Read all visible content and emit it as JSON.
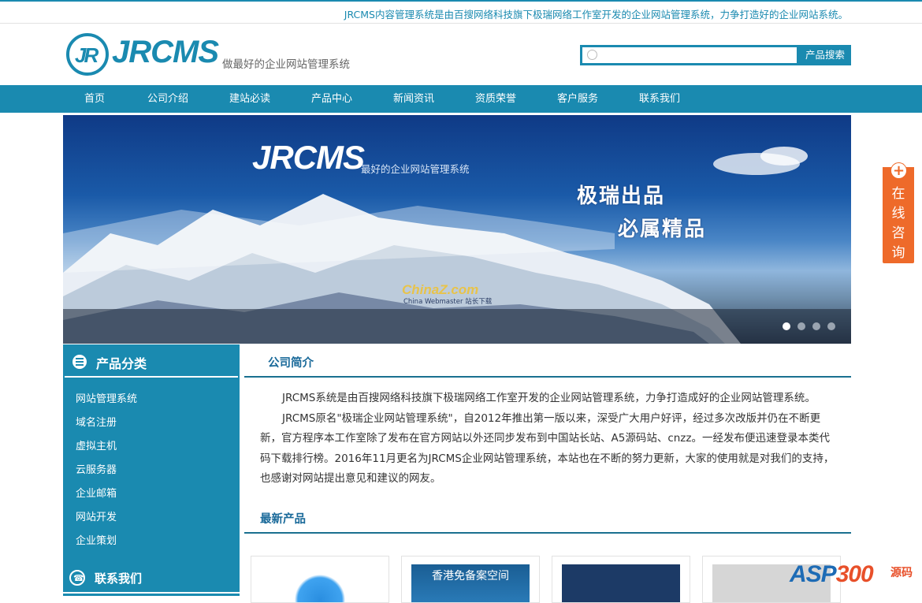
{
  "topbar": {
    "notice": "JRCMS内容管理系统是由百搜网络科技旗下极瑞网络工作室开发的企业网站管理系统，力争打造好的企业网站系统。"
  },
  "header": {
    "logo_mark": "JR",
    "logo_text": "JRCMS",
    "slogan": "做最好的企业网站管理系统",
    "search": {
      "placeholder": "",
      "button": "产品搜索"
    }
  },
  "nav": {
    "items": [
      "首页",
      "公司介绍",
      "建站必读",
      "产品中心",
      "新闻资讯",
      "资质荣誉",
      "客户服务",
      "联系我们"
    ]
  },
  "banner": {
    "logo": "JRCMS",
    "subtitle": "最好的企业网站管理系统",
    "line1": "极瑞出品",
    "line2": "必属精品",
    "watermark": "ChinaZ.com",
    "watermark_sub": "China Webmaster 站长下载",
    "active_slide": 1,
    "slide_count": 4
  },
  "sidebar": {
    "title": "产品分类",
    "items": [
      "网站管理系统",
      "域名注册",
      "虚拟主机",
      "云服务器",
      "企业邮箱",
      "网站开发",
      "企业策划"
    ],
    "contact_title": "联系我们"
  },
  "main": {
    "intro_title": "公司简介",
    "intro_paragraphs": [
      "JRCMS系统是由百搜网络科技旗下极瑞网络工作室开发的企业网站管理系统，力争打造成好的企业网站管理系统。",
      "JRCMS原名\"极瑞企业网站管理系统\"，自2012年推出第一版以来，深受广大用户好评，经过多次改版并仍在不断更新，官方程序本工作室除了发布在官方网站以外还同步发布到中国站长站、A5源码站、cnzz。一经发布便迅速登录本类代码下载排行榜。2016年11月更名为JRCMS企业网站管理系统，本站也在不断的努力更新，大家的使用就是对我们的支持，也感谢对网站提出意见和建议的网友。"
    ],
    "products_title": "最新产品",
    "product_labels": [
      "",
      "香港免备案空间",
      "",
      ""
    ]
  },
  "float_consult": {
    "label": "在线咨询",
    "plus": "+"
  },
  "corner_watermark": {
    "brand_a": "ASP",
    "brand_b": "300",
    "suffix": "源码"
  }
}
